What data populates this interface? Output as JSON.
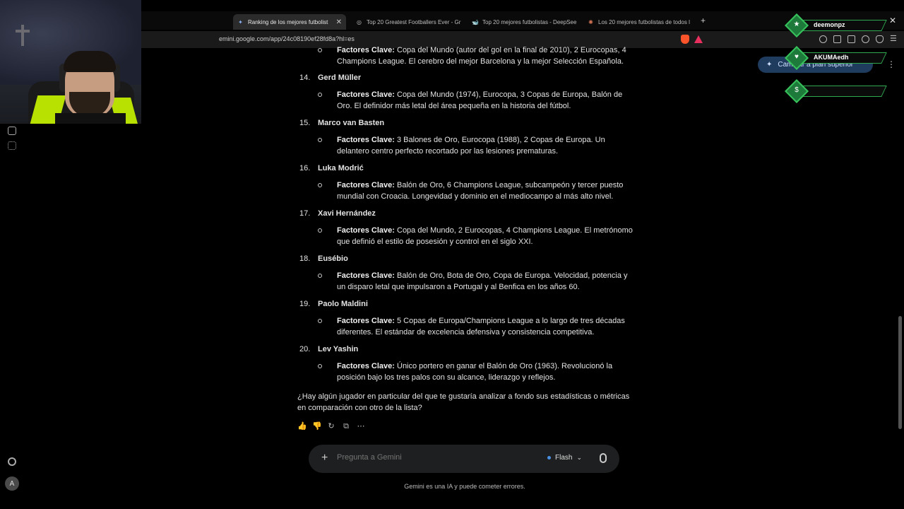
{
  "browser": {
    "tabs": [
      {
        "label": "Ranking de los mejores futbolist",
        "icon": "gemini-icon",
        "active": true
      },
      {
        "label": "Top 20 Greatest Footballers Ever - Gr",
        "icon": "grok-icon"
      },
      {
        "label": "Top 20 mejores futbolistas - DeepSee",
        "icon": "deepseek-icon"
      },
      {
        "label": "Los 20 mejores futbolistas de todos l",
        "icon": "claude-icon"
      }
    ],
    "url": "emini.google.com/app/24c08190ef28fd8a?hl=es"
  },
  "players": [
    {
      "num": "",
      "name": "",
      "label": "Factores Clave:",
      "desc": " Copa del Mundo (autor del gol en la final de 2010), 2 Eurocopas, 4 Champions League. El cerebro del mejor Barcelona y la mejor Selección Española."
    },
    {
      "num": "14.",
      "name": "Gerd Müller",
      "label": "Factores Clave:",
      "desc": " Copa del Mundo (1974), Eurocopa, 3 Copas de Europa, Balón de Oro. El definidor más letal del área pequeña en la historia del fútbol."
    },
    {
      "num": "15.",
      "name": "Marco van Basten",
      "label": "Factores Clave:",
      "desc": " 3 Balones de Oro, Eurocopa (1988), 2 Copas de Europa. Un delantero centro perfecto recortado por las lesiones prematuras."
    },
    {
      "num": "16.",
      "name": "Luka Modrić",
      "label": "Factores Clave:",
      "desc": " Balón de Oro, 6 Champions League, subcampeón y tercer puesto mundial con Croacia. Longevidad y dominio en el mediocampo al más alto nivel."
    },
    {
      "num": "17.",
      "name": "Xavi Hernández",
      "label": "Factores Clave:",
      "desc": " Copa del Mundo, 2 Eurocopas, 4 Champions League. El metrónomo que definió el estilo de posesión y control en el siglo XXI."
    },
    {
      "num": "18.",
      "name": "Eusébio",
      "label": "Factores Clave:",
      "desc": " Balón de Oro, Bota de Oro, Copa de Europa. Velocidad, potencia y un disparo letal que impulsaron a Portugal y al Benfica en los años 60."
    },
    {
      "num": "19.",
      "name": "Paolo Maldini",
      "label": "Factores Clave:",
      "desc": " 5 Copas de Europa/Champions League a lo largo de tres décadas diferentes. El estándar de excelencia defensiva y consistencia competitiva."
    },
    {
      "num": "20.",
      "name": "Lev Yashin",
      "label": "Factores Clave:",
      "desc": " Único portero en ganar el Balón de Oro (1963). Revolucionó la posición bajo los tres palos con su alcance, liderazgo y reflejos."
    }
  ],
  "question": "¿Hay algún jugador en particular del que te gustaría analizar a fondo sus estadísticas o métricas en comparación con otro de la lista?",
  "input": {
    "placeholder": "Pregunta a Gemini"
  },
  "model": "Flash",
  "disclaimer": "Gemini es una IA y puede cometer errores.",
  "upgrade": "Cambiar a plan superior",
  "avatar_letter": "A",
  "alerts": [
    {
      "label": "deemonpz",
      "icon": "star-icon"
    },
    {
      "label": "AKUMAedh",
      "icon": "heart-icon"
    },
    {
      "label": "",
      "icon": "dollar-icon"
    }
  ]
}
